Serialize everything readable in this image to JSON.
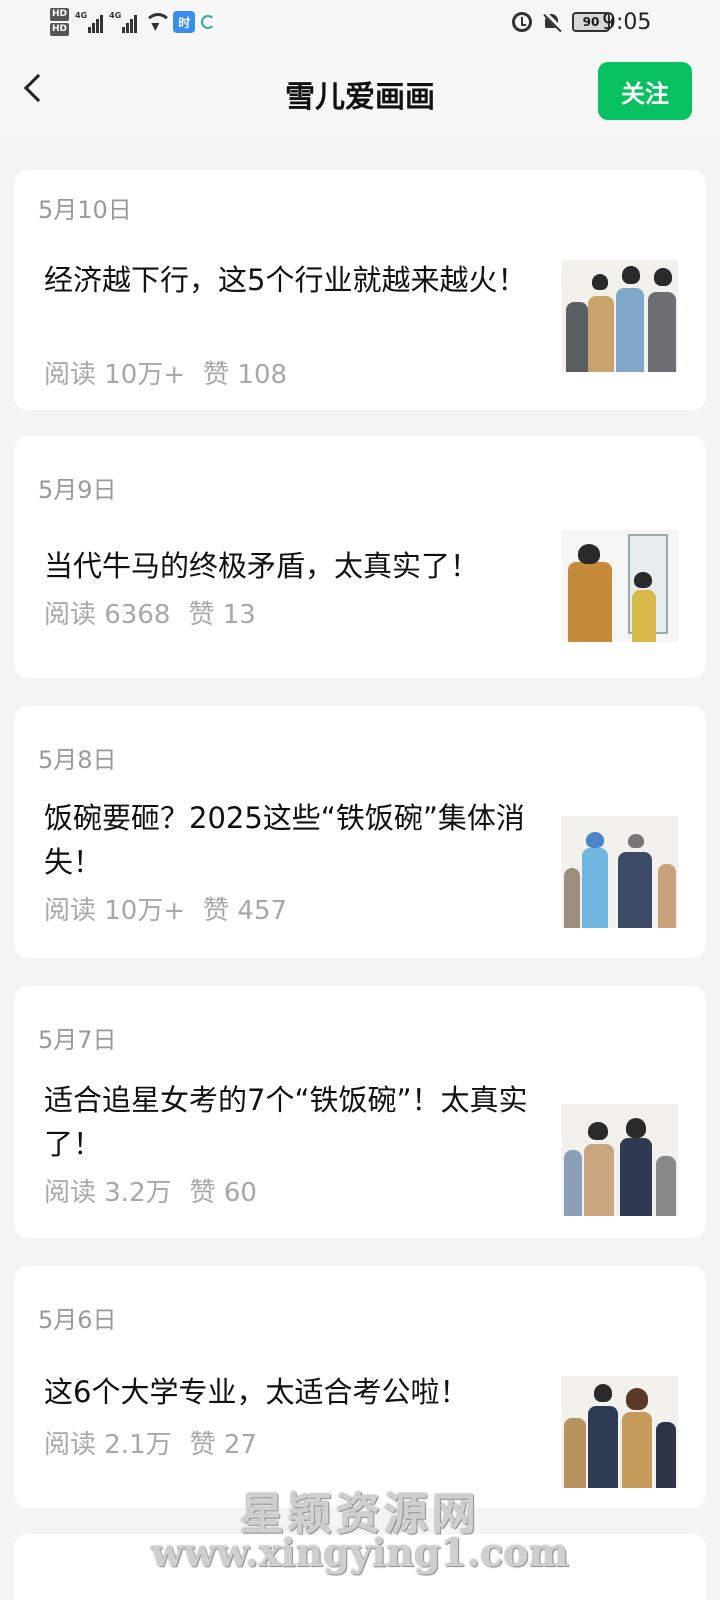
{
  "status_bar": {
    "hd1": "HD",
    "hd2": "HD",
    "net1": "4G",
    "net2": "4G",
    "time_app": "时",
    "battery": "90",
    "time": "9:05"
  },
  "header": {
    "title": "雪儿爱画画",
    "follow_label": "关注"
  },
  "articles": [
    {
      "date": "5月10日",
      "title": "经济越下行，这5个行业就越来越火！",
      "reads": "阅读 10万+",
      "likes": "赞 108"
    },
    {
      "date": "5月9日",
      "title": "当代牛马的终极矛盾，太真实了！",
      "reads": "阅读 6368",
      "likes": "赞 13"
    },
    {
      "date": "5月8日",
      "title": "饭碗要砸？2025这些“铁饭碗”集体消失！",
      "reads": "阅读 10万+",
      "likes": "赞 457"
    },
    {
      "date": "5月7日",
      "title": "适合追星女考的7个“铁饭碗”！太真实了！",
      "reads": "阅读 3.2万",
      "likes": "赞 60"
    },
    {
      "date": "5月6日",
      "title": "这6个大学专业，太适合考公啦！",
      "reads": "阅读 2.1万",
      "likes": "赞 27"
    }
  ],
  "watermark": {
    "line1": "星颖资源网",
    "line2": "www.xingying1.com"
  }
}
